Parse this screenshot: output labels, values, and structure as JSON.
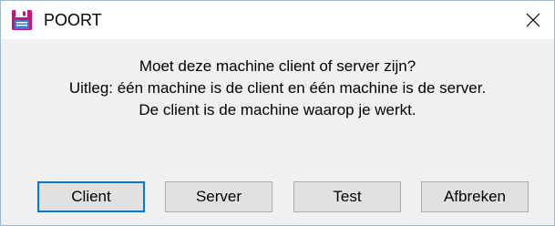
{
  "window": {
    "title": "POORT",
    "icon": "floppy-disk-icon",
    "close_icon": "close-icon"
  },
  "message": {
    "line1": "Moet deze machine client of server zijn?",
    "line2": "Uitleg: één machine is de client en één machine is de server.",
    "line3": "De client is de machine waarop je werkt."
  },
  "buttons": {
    "client": "Client",
    "server": "Server",
    "test": "Test",
    "abort": "Afbreken"
  },
  "colors": {
    "titlebar_bg": "#ffffff",
    "dialog_bg": "#f0f0f0",
    "button_bg": "#e1e1e1",
    "default_button_border": "#0078d7",
    "icon_magenta": "#c8157a",
    "icon_blue": "#3a7bd5"
  }
}
